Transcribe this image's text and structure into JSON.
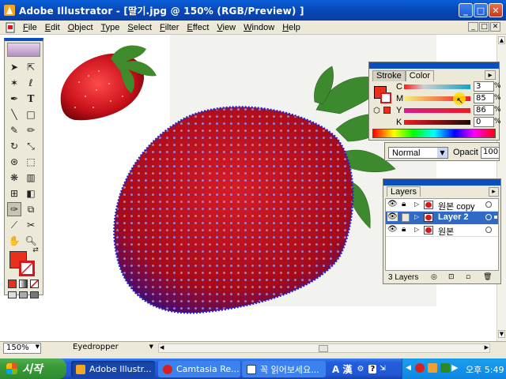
{
  "window": {
    "title": "Adobe Illustrator - [딸기.jpg @ 150% (RGB/Preview) ]",
    "min_label": "_",
    "max_label": "□",
    "close_label": "✕"
  },
  "menu": [
    "File",
    "Edit",
    "Object",
    "Type",
    "Select",
    "Filter",
    "Effect",
    "View",
    "Window",
    "Help"
  ],
  "mdi": {
    "min": "_",
    "max": "□",
    "close": "✕"
  },
  "color_panel": {
    "tabs": [
      "Stroke",
      "Color"
    ],
    "channels": [
      {
        "label": "C",
        "value": "3"
      },
      {
        "label": "M",
        "value": "85"
      },
      {
        "label": "Y",
        "value": "86"
      },
      {
        "label": "K",
        "value": "0"
      }
    ],
    "percent": "%",
    "fill_color": "#e8301c"
  },
  "transparency_panel": {
    "blend_mode": "Normal",
    "opacity_label": "Opacit",
    "opacity_value": "100"
  },
  "layers_panel": {
    "tab": "Layers",
    "layers": [
      {
        "name": "원본 copy",
        "selected": false
      },
      {
        "name": "Layer 2",
        "selected": true
      },
      {
        "name": "원본",
        "selected": false
      }
    ],
    "count_label": "3 Layers"
  },
  "statusbar": {
    "zoom": "150%",
    "tool": "Eyedropper"
  },
  "taskbar": {
    "start": "시작",
    "tasks": [
      "Adobe Illustr...",
      "Camtasia Re...",
      "꼭 읽어보세요..."
    ],
    "ime": "A 漢",
    "time": "오후 5:49"
  },
  "colors": {
    "strawberry": "#d8161e",
    "mesh_point": "#2a2ad8",
    "selection": "#1f4fb0"
  }
}
